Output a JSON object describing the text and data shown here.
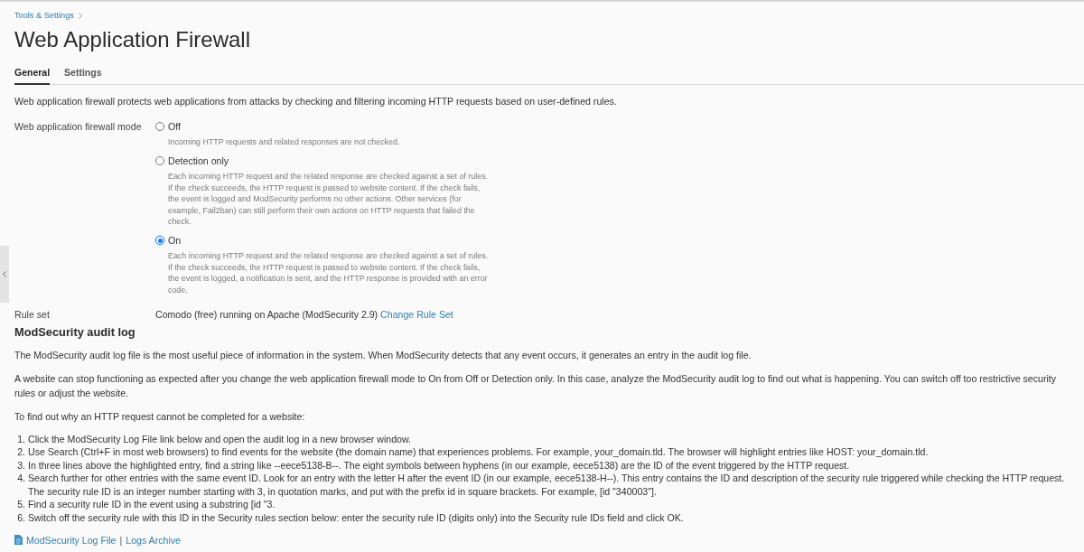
{
  "breadcrumb": {
    "label": "Tools & Settings"
  },
  "title": "Web Application Firewall",
  "tabs": [
    {
      "label": "General",
      "selected": true
    },
    {
      "label": "Settings",
      "selected": false
    }
  ],
  "description": "Web application firewall protects web applications from attacks by checking and filtering incoming HTTP requests based on user-defined rules.",
  "firewall_mode": {
    "label": "Web application firewall mode",
    "options": [
      {
        "label": "Off",
        "hint": "Incoming HTTP requests and related responses are not checked.",
        "selected": false
      },
      {
        "label": "Detection only",
        "hint": "Each incoming HTTP request and the related response are checked against a set of rules. If the check succeeds, the HTTP request is passed to website content. If the check fails, the event is logged and ModSecurity performs no other actions. Other services (for example, Fail2ban) can still perform their own actions on HTTP requests that failed the check.",
        "selected": false
      },
      {
        "label": "On",
        "hint": "Each incoming HTTP request and the related response are checked against a set of rules. If the check succeeds, the HTTP request is passed to website content. If the check fails, the event is logged, a notification is sent, and the HTTP response is provided with an error code.",
        "selected": true
      }
    ]
  },
  "rule_set": {
    "label": "Rule set",
    "value": "Comodo (free) running on Apache (ModSecurity 2.9)",
    "link": "Change Rule Set"
  },
  "audit_log": {
    "heading": "ModSecurity audit log",
    "paragraphs": [
      "The ModSecurity audit log file is the most useful piece of information in the system. When ModSecurity detects that any event occurs, it generates an entry in the audit log file.",
      "A website can stop functioning as expected after you change the web application firewall mode to On from Off or Detection only. In this case, analyze the ModSecurity audit log to find out what is happening. You can switch off too restrictive security rules or adjust the website.",
      "To find out why an HTTP request cannot be completed for a website:"
    ],
    "steps": [
      {
        "number": "1.",
        "text": "Click the ModSecurity Log File link below and open the audit log in a new browser window."
      },
      {
        "number": "2.",
        "text": "Use Search (Ctrl+F in most web browsers) to find events for the website (the domain name) that experiences problems. For example, your_domain.tld. The browser will highlight entries like HOST: your_domain.tld."
      },
      {
        "number": "3.",
        "text": "In three lines above the highlighted entry, find a string like --eece5138-B--. The eight symbols between hyphens (in our example, eece5138) are the ID of the event triggered by the HTTP request."
      },
      {
        "number": "4.",
        "text": "Search further for other entries with the same event ID. Look for an entry with the letter H after the event ID (in our example, eece5138-H--). This entry contains the ID and description of the security rule triggered while checking the HTTP request. The security rule ID is an integer number starting with 3, in quotation marks, and put with the prefix id in square brackets. For example, [id \"340003\"]."
      },
      {
        "number": "5.",
        "text": "Find a security rule ID in the event using a substring [id \"3."
      },
      {
        "number": "6.",
        "text": "Switch off the security rule with this ID in the Security rules section below: enter the security rule ID (digits only) into the Security rule IDs field and click OK."
      }
    ],
    "links": [
      {
        "label": "ModSecurity Log File",
        "kind": "file"
      },
      {
        "label": "Logs Archive",
        "kind": "plain"
      }
    ],
    "link_separator": "|"
  }
}
